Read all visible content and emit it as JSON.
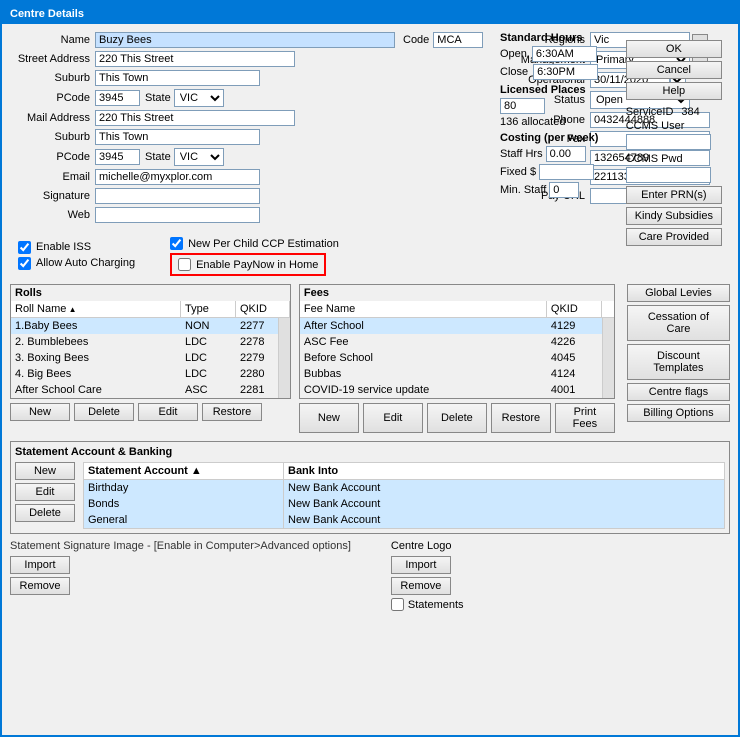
{
  "window": {
    "title": "Centre Details"
  },
  "form": {
    "name_label": "Name",
    "name_value": "Buzy Bees",
    "code_label": "Code",
    "code_value": "MCA",
    "street_label": "Street Address",
    "street_value": "220 This Street",
    "suburb_label": "Suburb",
    "suburb_value": "This Town",
    "pcode_label": "PCode",
    "pcode_value": "3945",
    "state_label": "State",
    "state_value": "VIC",
    "mail_label": "Mail Address",
    "mail_value": "220 This Street",
    "suburb2_value": "This Town",
    "pcode2_value": "3945",
    "state2_value": "VIC",
    "email_label": "Email",
    "email_value": "michelle@myxplor.com",
    "signature_label": "Signature",
    "web_label": "Web",
    "regions_label": "Regions",
    "regions_value": "Vic",
    "management_label": "Management",
    "management_value": "Primary",
    "operational_label": "Operational",
    "operational_value": "30/11/2020",
    "status_label": "Status",
    "status_value": "Open",
    "phone_label": "Phone",
    "phone_value": "0432444888",
    "fax_label": "Fax",
    "acn_label": "ACN",
    "acn_value": "132654789",
    "abn_label": "ABN",
    "abn_value": "221133449",
    "payurl_label": "Pay URL"
  },
  "standard_hours": {
    "label": "Standard Hours",
    "open_label": "Open",
    "open_value": "6:30AM",
    "close_label": "Close",
    "close_value": "6:30PM"
  },
  "licensed_places": {
    "label": "Licensed Places",
    "value": "80",
    "allocated": "136 allocated"
  },
  "costing": {
    "label": "Costing (per week)",
    "staff_hrs_label": "Staff Hrs",
    "staff_hrs_value": "0.00",
    "fixed_label": "Fixed $",
    "min_staff_label": "Min. Staff",
    "min_staff_value": "0"
  },
  "service_id": {
    "label": "ServiceID",
    "value": "384"
  },
  "ccms_user": {
    "label": "CCMS User"
  },
  "ccms_pwd": {
    "label": "CCMS Pwd"
  },
  "buttons": {
    "ok": "OK",
    "cancel": "Cancel",
    "help": "Help",
    "enter_prns": "Enter PRN(s)",
    "kindy_subsidies": "Kindy Subsidies",
    "care_provided": "Care Provided",
    "global_levies": "Global Levies",
    "cessation_of_care": "Cessation of Care",
    "discount_templates": "Discount Templates",
    "centre_flags": "Centre flags",
    "billing_options": "Billing Options"
  },
  "checkboxes": {
    "enable_iss": "Enable ISS",
    "enable_iss_checked": true,
    "allow_auto_charging": "Allow Auto Charging",
    "allow_auto_checked": true,
    "new_per_child": "New Per Child CCP Estimation",
    "new_per_child_checked": true,
    "enable_paynow": "Enable PayNow in Home",
    "enable_paynow_checked": false
  },
  "rolls": {
    "label": "Rolls",
    "headers": [
      "Roll Name",
      "Type",
      "QKID"
    ],
    "rows": [
      {
        "name": "1.Baby Bees",
        "type": "NON",
        "qkid": "2277"
      },
      {
        "name": "2. Bumblebees",
        "type": "LDC",
        "qkid": "2278"
      },
      {
        "name": "3. Boxing Bees",
        "type": "LDC",
        "qkid": "2279"
      },
      {
        "name": "4. Big Bees",
        "type": "LDC",
        "qkid": "2280"
      },
      {
        "name": "After School Care",
        "type": "ASC",
        "qkid": "2281"
      }
    ],
    "btn_new": "New",
    "btn_delete": "Delete",
    "btn_edit": "Edit",
    "btn_restore": "Restore"
  },
  "fees": {
    "label": "Fees",
    "headers": [
      "Fee Name",
      "QKID"
    ],
    "rows": [
      {
        "name": "After School",
        "qkid": "4129"
      },
      {
        "name": "ASC Fee",
        "qkid": "4226"
      },
      {
        "name": "Before School",
        "qkid": "4045"
      },
      {
        "name": "Bubbas",
        "qkid": "4124"
      },
      {
        "name": "COVID-19 service update",
        "qkid": "4001"
      }
    ],
    "btn_new": "New",
    "btn_edit": "Edit",
    "btn_delete": "Delete",
    "btn_restore": "Restore",
    "btn_print_fees": "Print Fees"
  },
  "statement": {
    "label": "Statement Account & Banking",
    "btn_new": "New",
    "btn_edit": "Edit",
    "btn_delete": "Delete",
    "headers": [
      "Statement Account",
      "Bank Into"
    ],
    "rows": [
      {
        "account": "Birthday",
        "bank": "New Bank Account"
      },
      {
        "account": "Bonds",
        "bank": "New Bank Account"
      },
      {
        "account": "General",
        "bank": "New Bank Account"
      }
    ]
  },
  "signature": {
    "label": "Statement Signature Image - [Enable in Computer>Advanced options]",
    "btn_import": "Import",
    "btn_remove": "Remove"
  },
  "logo": {
    "label": "Centre Logo",
    "btn_import": "Import",
    "btn_remove": "Remove",
    "statements_label": "Statements"
  }
}
